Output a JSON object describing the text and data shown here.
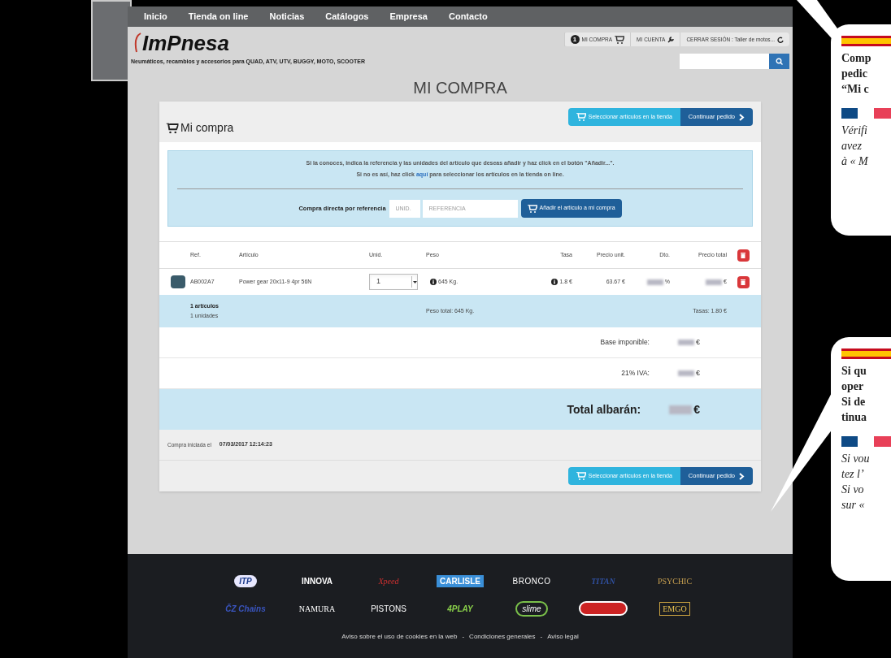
{
  "nav": {
    "items": [
      "Inicio",
      "Tienda on line",
      "Noticias",
      "Catálogos",
      "Empresa",
      "Contacto"
    ]
  },
  "header": {
    "logo": "ImPnesa",
    "tagline": "Neumáticos, recambios y accesorios para QUAD, ATV, UTV, BUGGY, MOTO, SCOOTER",
    "cart_count": "1",
    "links": [
      "MI COMPRA",
      "MI CUENTA",
      "CERRAR SESIÓN : Taller de motos..."
    ]
  },
  "page_title": "MI COMPRA",
  "card": {
    "title": "Mi compra",
    "buttons": [
      "Seleccionar artículos en la tienda",
      "Continuar pedido"
    ],
    "info": {
      "line_1": "Si la conoces, indica la referencia y las unidades del artículo que deseas añadir y haz click en el botón \"Añadir...\".",
      "line_2_before": "Si no es así, haz click",
      "link": "aquí",
      "line_2_after": "para seleccionar los artículos en la tienda on line.",
      "form_label": "Compra directa por referencia",
      "units_placeholder": "UNID.",
      "ref_placeholder": "REFERENCIA",
      "add_button": "Añadir el artículo a mi compra"
    },
    "table": {
      "columns": [
        "Ref.",
        "Artículo",
        "Unid.",
        "Peso",
        "Tasa",
        "Precio unit.",
        "Dto.",
        "Precio total"
      ],
      "rows": [
        {
          "ref": "AB002A7",
          "article": "Power gear 20x11-9 4pr 56N",
          "units": "1",
          "weight": "645 Kg.",
          "tax": "1.8 €",
          "unit_price": "63.67 €",
          "discount": "%",
          "total": "€"
        }
      ],
      "summary": {
        "articles": "1 artículos",
        "units": "1 unidades",
        "weight": "Peso total: 645 Kg.",
        "taxes": "Tasas: 1.80 €"
      },
      "totals": [
        {
          "label": "Base imponible:",
          "value": "€",
          "kind": "normal"
        },
        {
          "label": "21% IVA:",
          "value": "€",
          "kind": "normal"
        },
        {
          "label": "Total albarán:",
          "value": "€",
          "kind": "grand"
        }
      ]
    },
    "started_label": "Compra iniciada el",
    "started_date": "07/03/2017 12:14:23",
    "footer_buttons": [
      "Seleccionar artículos en la tienda",
      "Continuar pedido"
    ]
  },
  "footer": {
    "logos": [
      [
        {
          "kind": "text",
          "text": "ITP"
        },
        {
          "kind": "text",
          "text": "INNOVA"
        },
        {
          "kind": "text",
          "text": "Xpeed"
        },
        {
          "kind": "text",
          "text": "CARLISLE"
        },
        {
          "kind": "text",
          "text": "BRONCO"
        },
        {
          "kind": "text",
          "text": "TITAN"
        },
        {
          "kind": "text",
          "text": "PSYCHIC"
        }
      ],
      [
        {
          "kind": "text",
          "text": "ČZ Chains"
        },
        {
          "kind": "text",
          "text": "NAMURA"
        },
        {
          "kind": "text",
          "text": "PISTONS"
        },
        {
          "kind": "text",
          "text": "4PLAY"
        },
        {
          "kind": "text",
          "text": "slime"
        },
        {
          "kind": "graphic"
        },
        {
          "kind": "text",
          "text": "EMGO"
        }
      ]
    ],
    "links": [
      "Aviso sobre el uso de cookies en la web",
      "Condiciones generales",
      "Aviso legal"
    ],
    "separators": [
      "-",
      "-"
    ]
  },
  "callouts": [
    {
      "sections": [
        {
          "kind": "spanish",
          "lines": [
            "Comp",
            "pedic",
            "“Mi c"
          ]
        },
        {
          "kind": "french",
          "lines": [
            "Vérifi",
            "avez",
            "à « M"
          ]
        }
      ]
    },
    {
      "sections": [
        {
          "kind": "spanish",
          "lines": [
            "Si qu",
            "oper",
            "Si de",
            "tinua"
          ]
        },
        {
          "kind": "french",
          "lines": [
            "Si vou",
            "tez l’",
            "Si vo",
            "sur «"
          ]
        }
      ]
    }
  ]
}
